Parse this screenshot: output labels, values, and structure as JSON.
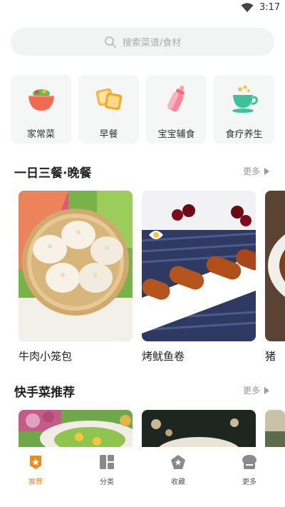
{
  "status": {
    "time": "3:17",
    "wifi_icon": "wifi-icon"
  },
  "search": {
    "placeholder": "搜索菜谱/食材",
    "icon": "search-icon"
  },
  "categories": [
    {
      "label": "家常菜",
      "icon": "salad-bowl-icon"
    },
    {
      "label": "早餐",
      "icon": "toast-icon"
    },
    {
      "label": "宝宝辅食",
      "icon": "baby-bottle-icon"
    },
    {
      "label": "食疗养生",
      "icon": "tea-cup-icon"
    }
  ],
  "sections": [
    {
      "title": "一日三餐·晚餐",
      "more_label": "更多",
      "cards": [
        {
          "label": "牛肉小笼包",
          "image": "steamed-buns-image"
        },
        {
          "label": "烤鱿鱼卷",
          "image": "grilled-squid-image"
        },
        {
          "label": "猪",
          "image": "pork-dish-image"
        }
      ]
    },
    {
      "title": "快手菜推荐",
      "more_label": "更多",
      "cards": [
        {
          "image": "salad-image"
        },
        {
          "image": "soup-image"
        },
        {
          "image": "dish-image"
        }
      ]
    }
  ],
  "tabbar": {
    "items": [
      {
        "label": "推荐",
        "icon": "recommend-icon",
        "active": true
      },
      {
        "label": "分类",
        "icon": "category-icon",
        "active": false
      },
      {
        "label": "收藏",
        "icon": "favorite-icon",
        "active": false
      },
      {
        "label": "更多",
        "icon": "more-icon",
        "active": false
      }
    ],
    "accent_color": "#f08a1e"
  }
}
